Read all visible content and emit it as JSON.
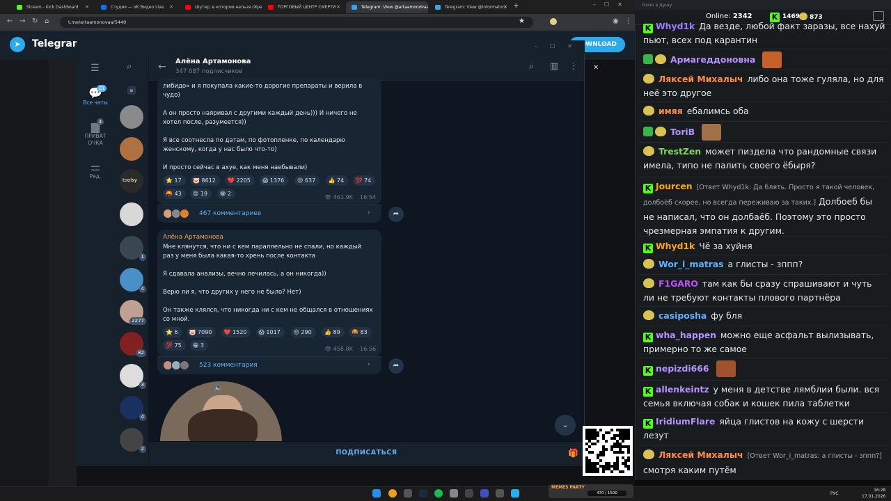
{
  "browser": {
    "tabs": [
      {
        "title": "Stream - Kick Dashboard",
        "color": "#53fc18"
      },
      {
        "title": "Студия — VK Видео Live",
        "color": "#0077ff"
      },
      {
        "title": "Шутер, в котором нельзя стре",
        "color": "#ff0000"
      },
      {
        "title": "ТОРГОВЫЙ ЦЕНТР СМЕРТИ - ",
        "color": "#ff0000"
      },
      {
        "title": "Telegram: View @artaamonovaa",
        "color": "#2aabee"
      },
      {
        "title": "Telegram: View @informatorz",
        "color": "#2aabee"
      }
    ],
    "url": "t.me/artaamonovaa/5440"
  },
  "tg_web": {
    "brand": "Telegram",
    "download_label": "DOWNLOAD"
  },
  "telegram": {
    "folders": [
      {
        "label": "Все чаты",
        "badge": "21"
      },
      {
        "label": "ПРИВАТ ОЧКА",
        "badge": "4"
      },
      {
        "label": "Ред.",
        "badge": ""
      }
    ],
    "chat_avatars": [
      {
        "badge": "",
        "color": "#8a8a8a"
      },
      {
        "badge": "",
        "color": "#b07040"
      },
      {
        "badge": "",
        "color": "#2a2a2a",
        "text": "toolsy"
      },
      {
        "badge": "",
        "color": "#d8d8d8"
      },
      {
        "badge": "1",
        "color": "#3a4650"
      },
      {
        "badge": "4",
        "color": "#4a90c8"
      },
      {
        "badge": "2277",
        "color": "#c0a090"
      },
      {
        "badge": "82",
        "color": "#802020"
      },
      {
        "badge": "3",
        "color": "#ddd"
      },
      {
        "badge": "4",
        "color": "#1a3060"
      },
      {
        "badge": "2",
        "color": "#444"
      }
    ],
    "channel": {
      "title": "Алёна Артамонова",
      "subscribers": "347 087 подписчиков"
    },
    "messages": [
      {
        "lines": [
          "либидо» и я покупала какие-то дорогие препараты и верила в",
          "чудо)",
          "",
          "А он просто наяривал с другими каждый день))) И ничего не",
          "хотел после, разумеется))",
          "",
          "Я все соотнесла по датам, по фотопленке, по календарю",
          "женскому, когда у нас было что-то)",
          "",
          "И просто сейчас в ахуе, как меня наебывали)"
        ],
        "reactions": [
          {
            "e": "⭐",
            "n": "17"
          },
          {
            "e": "🐷",
            "n": "8612"
          },
          {
            "e": "❤️",
            "n": "2205"
          },
          {
            "e": "😱",
            "n": "1376"
          },
          {
            "e": "😢",
            "n": "637"
          },
          {
            "e": "👍",
            "n": "74"
          },
          {
            "e": "💯",
            "n": "74"
          },
          {
            "e": "🤬",
            "n": "43"
          },
          {
            "e": "😍",
            "n": "19"
          },
          {
            "e": "😁",
            "n": "2"
          }
        ],
        "views": "461.9K",
        "time": "16:54",
        "comments": "467 комментариев"
      },
      {
        "author": "Алёна Артамонова",
        "lines": [
          "Мне клянутся, что ни с кем параллельно не спали, но каждый",
          "раз у меня была какая-то хрень после контакта",
          "",
          "Я сдавала анализы, вечно лечилась, а он никогда))",
          "",
          "Верю ли я, что других у него не было? Нет)",
          "",
          "Он также клялся, что никогда ни с кем не общался в отношениях",
          "со мной."
        ],
        "reactions": [
          {
            "e": "⭐",
            "n": "6"
          },
          {
            "e": "🐷",
            "n": "7090"
          },
          {
            "e": "❤️",
            "n": "1520"
          },
          {
            "e": "😱",
            "n": "1017"
          },
          {
            "e": "😢",
            "n": "290"
          },
          {
            "e": "👍",
            "n": "89"
          },
          {
            "e": "🤬",
            "n": "83"
          },
          {
            "e": "💯",
            "n": "75"
          },
          {
            "e": "😁",
            "n": "3"
          }
        ],
        "views": "458.8K",
        "time": "16:56",
        "comments": "523 комментария"
      }
    ],
    "subscribe_label": "ПОДПИСАТЬСЯ"
  },
  "chat_overlay": {
    "window_title": "Окно в душу",
    "online_label": "Online:",
    "online_count": "2342",
    "kick_count": "1469",
    "coin_count": "873",
    "messages": [
      {
        "badge": "kick",
        "user": "Whyd1k",
        "color": "#9b7bff",
        "text": "Да везде, любой факт заразы, все нахуй пьют, всех под карантин",
        "reply": ""
      },
      {
        "badge": "green-egg",
        "user": "Армагеддоновна",
        "color": "#b593ff",
        "text": "",
        "reply": "",
        "emote": "#c8602a"
      },
      {
        "badge": "egg",
        "user": "Ляксей Михалыч",
        "color": "#ff8c42",
        "text": "либо она тоже гуляла, но для неё это  другое",
        "reply": ""
      },
      {
        "badge": "egg",
        "user": "имяя",
        "color": "#ff8c42",
        "text": "ебалимсь оба",
        "reply": ""
      },
      {
        "badge": "green-egg",
        "user": "ToriB",
        "color": "#b593ff",
        "text": "",
        "reply": "",
        "emote": "#a07048"
      },
      {
        "badge": "egg",
        "user": "TrestZen",
        "color": "#7ed957",
        "text": "может пиздела что рандомные связи имела, типо не палить своего ёбыря?",
        "reply": ""
      },
      {
        "badge": "kick",
        "user": "Jourcen",
        "color": "#ffa500",
        "text": "Долбоеб бы не написал, что он долбаёб. Поэтому это просто чрезмерная эмпатия к другим.",
        "reply": "[Ответ Whyd1k: Да блять. Просто я такой человек, долбоёб скорее, но всегда переживаю за таких.]"
      },
      {
        "badge": "kick",
        "user": "Whyd1k",
        "color": "#ffa500",
        "text": "Чё за хуйня",
        "reply": ""
      },
      {
        "badge": "egg",
        "user": "Wor_i_matras",
        "color": "#5fb0ff",
        "text": "а глисты - зппп?",
        "reply": ""
      },
      {
        "badge": "egg",
        "user": "F1GARO",
        "color": "#c050ff",
        "text": "там как бы сразу спрашивают и чуть ли не требуют контакты плового партнёра",
        "reply": ""
      },
      {
        "badge": "egg",
        "user": "casiposha",
        "color": "#5fb0ff",
        "text": "фу бля",
        "reply": ""
      },
      {
        "badge": "kick",
        "user": "wha_happen",
        "color": "#b593ff",
        "text": "можно еще асфальт вылизывать, примерно то же самое",
        "reply": ""
      },
      {
        "badge": "kick",
        "user": "nepizdi666",
        "color": "#b593ff",
        "text": "",
        "reply": "",
        "emote": "#a0522d"
      },
      {
        "badge": "kick",
        "user": "allenkeintz",
        "color": "#b593ff",
        "text": "у меня в детстве лямблии были. вся семья включая собак и кошек пила таблетки",
        "reply": ""
      },
      {
        "badge": "kick",
        "user": "IridiumFlare",
        "color": "#b593ff",
        "text": "яйца глистов на кожу с шерсти лезут",
        "reply": ""
      },
      {
        "badge": "egg",
        "user": "Ляксей Михалыч",
        "color": "#ff8c42",
        "text": "смотря каким путём",
        "reply": "[Ответ Wor_i_matras: а глисты - зппп?]"
      }
    ]
  },
  "taskbar": {
    "lang": "РУС",
    "time": "16:28",
    "date": "17.01.2026",
    "memes_label": "MEMES PARTY",
    "memes_count": "470 / 1500"
  }
}
